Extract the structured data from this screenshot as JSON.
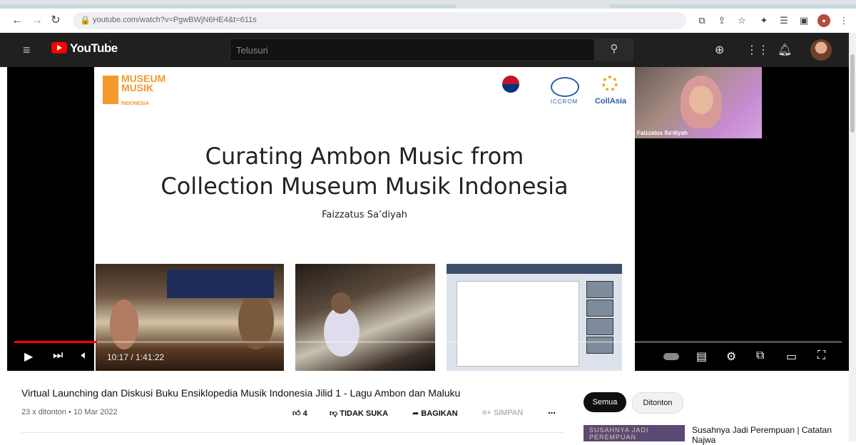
{
  "browser": {
    "url": "youtube.com/watch?v=PgwBWjN6HE4&t=611s"
  },
  "header": {
    "logo": "YouTube",
    "search_placeholder": "Telusuri"
  },
  "slide": {
    "title_line1": "Curating Ambon Music from",
    "title_line2": "Collection Museum Musik Indonesia",
    "author": "Faizzatus Sa’diyah",
    "museum_logo_line1": "MUSEUM",
    "museum_logo_line2": "MUSIK",
    "museum_logo_line3": "INDONESIA",
    "partner_iccrom": "ICCROM",
    "partner_collasia": "CollAsia"
  },
  "pip": {
    "name": "Faizzatus Sa'diyah"
  },
  "player": {
    "time_current": "10:17",
    "time_total": "1:41:22",
    "progress": 0.1
  },
  "video": {
    "title": "Virtual Launching dan Diskusi Buku Ensiklopedia Musik Indonesia Jilid 1 - Lagu Ambon dan Maluku",
    "meta": "23 x ditonton • 10 Mar 2022",
    "like_count": "4",
    "dislike_label": "TIDAK SUKA",
    "share_label": "BAGIKAN",
    "save_label": "SIMPAN"
  },
  "chips": [
    "Semua",
    "Ditonton"
  ],
  "recommendation": {
    "thumb_text": "SUSAHNYA JADI PEREMPUAN",
    "title": "Susahnya Jadi Perempuan | Catatan Najwa"
  }
}
